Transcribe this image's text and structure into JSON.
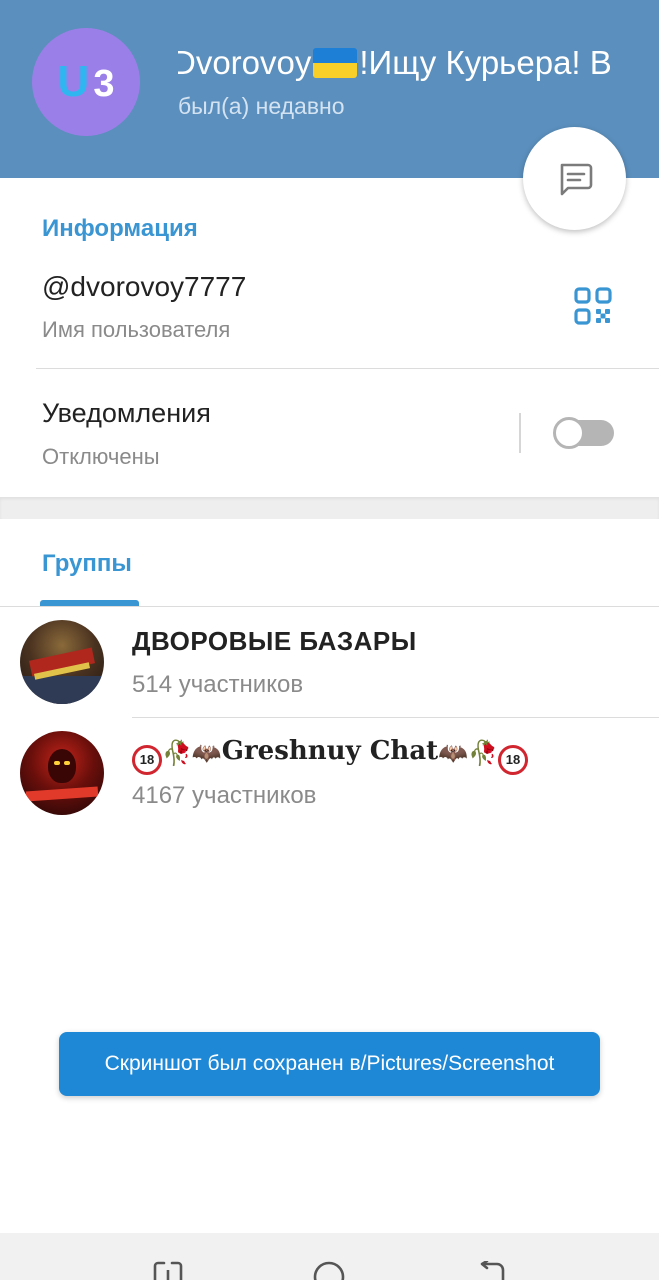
{
  "header": {
    "avatar_letters": [
      "U",
      "3"
    ],
    "title_before_flag": "Dvorovoy",
    "title_after_flag": "!Ищу Курьера! В",
    "status": "был(а) недавно",
    "colors": {
      "bar": "#5b8fbd",
      "avatar": "#9b7fe8"
    }
  },
  "fab": {
    "icon": "message-icon"
  },
  "info": {
    "section_title": "Информация",
    "username": {
      "value": "@dvorovoy7777",
      "label": "Имя пользователя",
      "icon": "qr-code-icon"
    },
    "notifications": {
      "title": "Уведомления",
      "status": "Отключены",
      "toggle_on": false
    }
  },
  "groups": {
    "tab_label": "Группы",
    "items": [
      {
        "name": "ДВОРОВЫЕ БАЗАРЫ",
        "members": "514 участников"
      },
      {
        "name": "🔞🥀🦇Greshnuy Chat🦇🥀🔞",
        "name_core": "Greshnuy Chat",
        "members": "4167 участников"
      }
    ]
  },
  "toast": {
    "text": "Скриншот был сохранен в/Pictures/Screenshot"
  },
  "navbar": {
    "buttons": [
      "recents-icon",
      "home-icon",
      "back-icon"
    ]
  },
  "accent_color": "#3a95d3"
}
